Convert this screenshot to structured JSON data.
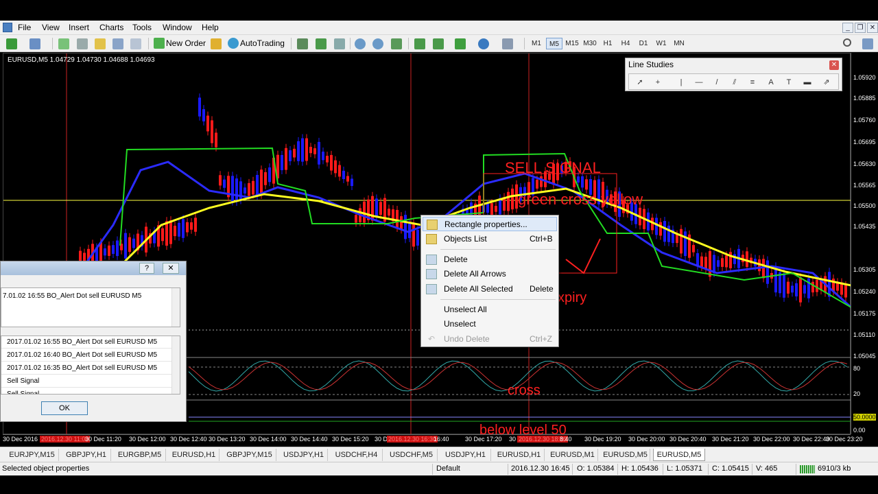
{
  "menubar": {
    "items": [
      "File",
      "View",
      "Insert",
      "Charts",
      "Tools",
      "Window",
      "Help"
    ]
  },
  "toolbar": {
    "new_order": "New Order",
    "autotrading": "AutoTrading",
    "timeframes": [
      "M1",
      "M5",
      "M15",
      "M30",
      "H1",
      "H4",
      "D1",
      "W1",
      "MN"
    ],
    "active_timeframe": "M5"
  },
  "chart": {
    "title": "EURUSD,M5  1.04729 1.04730 1.04688 1.04693",
    "price_labels": [
      "1.05920",
      "1.05885",
      "1.05760",
      "1.05695",
      "1.05630",
      "1.05565",
      "1.05500",
      "1.05435",
      "1.05305",
      "1.05240",
      "1.05175",
      "1.05110",
      "1.05045",
      "80",
      "20",
      "50.0000",
      "0.00"
    ],
    "time_labels": [
      "30 Dec 2016",
      "2016.12.30 11:00",
      "30 Dec 11:20",
      "30 Dec 12:00",
      "30 Dec 12:40",
      "30 Dec 13:20",
      "30 Dec 14:00",
      "30 Dec 14:40",
      "30 Dec 15:20",
      "30 Dec 16:00",
      "2016.12.30 16:30",
      "16:40",
      "30 Dec 17:20",
      "30 Dec 18:00",
      "2016.12.30 18:30",
      "8:40",
      "30 Dec 19:20",
      "30 Dec 20:00",
      "30 Dec 20:40",
      "30 Dec 21:20",
      "30 Dec 22:00",
      "30 Dec 22:40",
      "30 Dec 23:20"
    ],
    "annotations": {
      "sell_signal": "SELL SIGNAL",
      "green_cross": "green cross yellow",
      "expiry": "xpiry",
      "cross": "cross",
      "below_level": "below level 50"
    }
  },
  "line_studies": {
    "title": "Line Studies",
    "tools": [
      "cursor-icon",
      "crosshair-icon",
      "vertical-line-icon",
      "horizontal-line-icon",
      "trendline-icon",
      "channel-icon",
      "fibonacci-icon",
      "text-icon",
      "text-label-icon",
      "rectangle-icon",
      "arrows-icon"
    ]
  },
  "alert_dialog": {
    "help": "?",
    "close": "✕",
    "message": "7.01.02 16:55 BO_Alert Dot sell EURUSD M5",
    "rows": [
      "2017.01.02 16:55 BO_Alert Dot sell EURUSD M5",
      "2017.01.02 16:40 BO_Alert Dot sell EURUSD M5",
      "2017.01.02 16:35 BO_Alert Dot sell EURUSD M5",
      "Sell Signal",
      "Sell Signal"
    ],
    "ok": "OK"
  },
  "context_menu": {
    "items": [
      {
        "label": "Rectangle properties...",
        "shortcut": ""
      },
      {
        "label": "Objects List",
        "shortcut": "Ctrl+B"
      },
      {
        "label": "Delete",
        "shortcut": ""
      },
      {
        "label": "Delete All Arrows",
        "shortcut": ""
      },
      {
        "label": "Delete All Selected",
        "shortcut": "Delete"
      },
      {
        "label": "Unselect All",
        "shortcut": ""
      },
      {
        "label": "Unselect",
        "shortcut": ""
      },
      {
        "label": "Undo Delete",
        "shortcut": "Ctrl+Z"
      }
    ]
  },
  "tabs": [
    "EURJPY,M15",
    "GBPJPY,H1",
    "EURGBP,M5",
    "EURUSD,H1",
    "GBPJPY,M15",
    "USDJPY,H1",
    "USDCHF,H4",
    "USDCHF,M5",
    "USDJPY,H1",
    "EURUSD,H1",
    "EURUSD,M1",
    "EURUSD,M5",
    "EURUSD,M5"
  ],
  "active_tab": 12,
  "status": {
    "hint": "Selected object properties",
    "profile": "Default",
    "datetime": "2016.12.30 16:45",
    "open": "O: 1.05384",
    "high": "H: 1.05436",
    "low": "L: 1.05371",
    "close": "C: 1.05415",
    "volume": "V: 465",
    "traffic": "6910/3 kb"
  },
  "colors": {
    "bull": "#1a1aff",
    "bear": "#ff1a1a",
    "ma_fast": "#2b2bff",
    "ma_slow": "#ffff20",
    "channel": "#22dd22",
    "annotation": "#ff2020"
  }
}
